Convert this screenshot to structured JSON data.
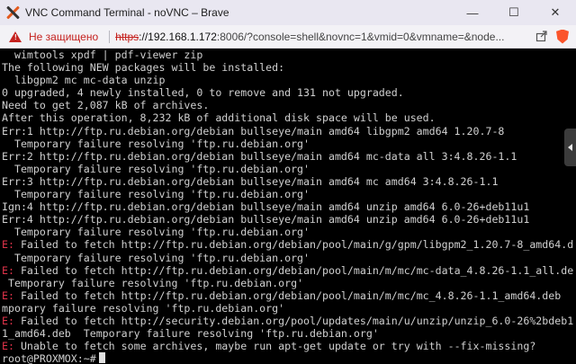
{
  "window": {
    "title": "VNC Command Terminal - noVNC – Brave",
    "minimize_glyph": "—",
    "maximize_glyph": "☐",
    "close_glyph": "✕"
  },
  "addressbar": {
    "security_label": "Не защищено",
    "url_scheme": "https",
    "url_host": "://192.168.1.172",
    "url_rest": ":8006/?console=shell&novnc=1&vmid=0&vmname=&node..."
  },
  "terminal": {
    "lines": [
      {
        "prefix": "",
        "text": "  wimtools xpdf | pdf-viewer zip"
      },
      {
        "prefix": "",
        "text": "The following NEW packages will be installed:"
      },
      {
        "prefix": "",
        "text": "  libgpm2 mc mc-data unzip"
      },
      {
        "prefix": "",
        "text": "0 upgraded, 4 newly installed, 0 to remove and 131 not upgraded."
      },
      {
        "prefix": "",
        "text": "Need to get 2,087 kB of archives."
      },
      {
        "prefix": "",
        "text": "After this operation, 8,232 kB of additional disk space will be used."
      },
      {
        "prefix": "",
        "text": "Err:1 http://ftp.ru.debian.org/debian bullseye/main amd64 libgpm2 amd64 1.20.7-8"
      },
      {
        "prefix": "",
        "text": "  Temporary failure resolving 'ftp.ru.debian.org'"
      },
      {
        "prefix": "",
        "text": "Err:2 http://ftp.ru.debian.org/debian bullseye/main amd64 mc-data all 3:4.8.26-1.1"
      },
      {
        "prefix": "",
        "text": "  Temporary failure resolving 'ftp.ru.debian.org'"
      },
      {
        "prefix": "",
        "text": "Err:3 http://ftp.ru.debian.org/debian bullseye/main amd64 mc amd64 3:4.8.26-1.1"
      },
      {
        "prefix": "",
        "text": "  Temporary failure resolving 'ftp.ru.debian.org'"
      },
      {
        "prefix": "",
        "text": "Ign:4 http://ftp.ru.debian.org/debian bullseye/main amd64 unzip amd64 6.0-26+deb11u1"
      },
      {
        "prefix": "",
        "text": "Err:4 http://ftp.ru.debian.org/debian bullseye/main amd64 unzip amd64 6.0-26+deb11u1"
      },
      {
        "prefix": "",
        "text": "  Temporary failure resolving 'ftp.ru.debian.org'"
      },
      {
        "prefix": "E:",
        "text": " Failed to fetch http://ftp.ru.debian.org/debian/pool/main/g/gpm/libgpm2_1.20.7-8_amd64.d"
      },
      {
        "prefix": "",
        "text": "  Temporary failure resolving 'ftp.ru.debian.org'"
      },
      {
        "prefix": "E:",
        "text": " Failed to fetch http://ftp.ru.debian.org/debian/pool/main/m/mc/mc-data_4.8.26-1.1_all.de"
      },
      {
        "prefix": "",
        "text": " Temporary failure resolving 'ftp.ru.debian.org'"
      },
      {
        "prefix": "E:",
        "text": " Failed to fetch http://ftp.ru.debian.org/debian/pool/main/m/mc/mc_4.8.26-1.1_amd64.deb"
      },
      {
        "prefix": "",
        "text": "mporary failure resolving 'ftp.ru.debian.org'"
      },
      {
        "prefix": "E:",
        "text": " Failed to fetch http://security.debian.org/pool/updates/main/u/unzip/unzip_6.0-26%2bdeb1"
      },
      {
        "prefix": "",
        "text": "1_amd64.deb  Temporary failure resolving 'ftp.ru.debian.org'"
      },
      {
        "prefix": "E:",
        "text": " Unable to fetch some archives, maybe run apt-get update or try with --fix-missing?"
      },
      {
        "prefix": "",
        "text": "root@PROXMOX:~#"
      }
    ]
  },
  "colors": {
    "error_prefix": "#e0334a",
    "terminal_text": "#d0d0d0",
    "terminal_bg": "#000000",
    "insecure_red": "#c5221f"
  },
  "icons": {
    "app": "proxmox-x-icon",
    "warning": "warning-triangle-icon",
    "share": "share-icon",
    "brave": "brave-lion-icon",
    "side_handle": "chevron-left-icon"
  }
}
